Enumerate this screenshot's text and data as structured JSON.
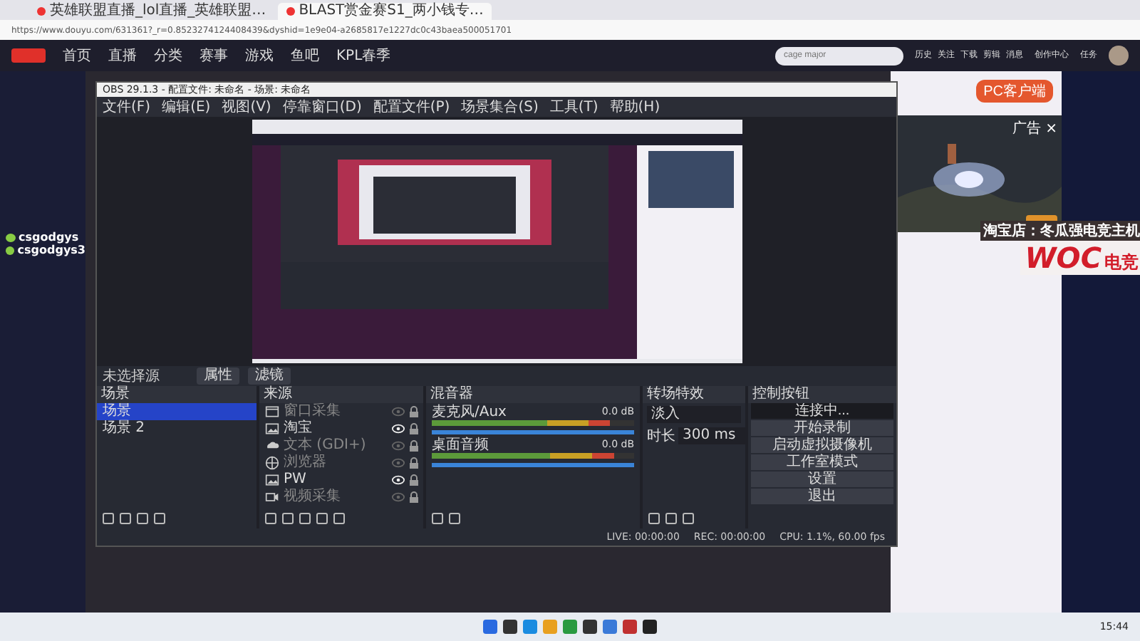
{
  "browser": {
    "tabs": [
      {
        "title": "英雄联盟直播_lol直播_英雄联盟…",
        "selected": false
      },
      {
        "title": "BLAST赏金赛S1_两小钱专…",
        "selected": true
      }
    ],
    "url": "https://www.douyu.com/631361?_r=0.8523274124408439&dyshid=1e9e04-a2685817e1227dc0c43baea500051701"
  },
  "site_nav": {
    "items": [
      "首页",
      "直播",
      "分类",
      "赛事",
      "游戏",
      "鱼吧",
      "KPL春季"
    ],
    "search": {
      "placeholder": "cage major"
    },
    "user_items": [
      "历史",
      "关注",
      "下载",
      "剪辑",
      "消息",
      "创作中心",
      "任务"
    ]
  },
  "chat": [
    "csgodgys",
    "csgodgys3"
  ],
  "obs": {
    "title": "OBS 29.1.3 - 配置文件: 未命名 - 场景: 未命名",
    "menu": [
      "文件(F)",
      "编辑(E)",
      "视图(V)",
      "停靠窗口(D)",
      "配置文件(P)",
      "场景集合(S)",
      "工具(T)",
      "帮助(H)"
    ],
    "source_bar": {
      "label": "未选择源",
      "buttons": [
        "属性",
        "滤镜"
      ]
    },
    "docks": {
      "scenes": {
        "title": "场景",
        "items": [
          {
            "name": "场景",
            "selected": true
          },
          {
            "name": "场景 2",
            "selected": false
          }
        ]
      },
      "sources": {
        "title": "来源",
        "items": [
          {
            "name": "窗口采集",
            "kind": "window",
            "visible": false
          },
          {
            "name": "淘宝",
            "visible": true
          },
          {
            "name": "文本 (GDI+)",
            "kind": "text",
            "visible": false
          },
          {
            "name": "浏览器",
            "kind": "browser",
            "visible": false
          },
          {
            "name": "PW",
            "visible": true
          },
          {
            "name": "视频采集",
            "kind": "video",
            "visible": false
          }
        ]
      },
      "mixer": {
        "title": "混音器",
        "channels": [
          {
            "name": "麦克风/Aux",
            "reading": "0.0 dB",
            "level": 0.88,
            "volume": {
              "level": 1
            }
          },
          {
            "name": "桌面音频",
            "reading": "0.0 dB",
            "level": 0.9,
            "volume": {
              "level": 1
            }
          }
        ]
      },
      "transitions": {
        "title": "转场特效",
        "transition": "淡入",
        "duration_label": "时长",
        "duration": "300 ms"
      },
      "controls": {
        "title": "控制按钮",
        "buttons": [
          {
            "label": "连接中...",
            "active": true
          },
          {
            "label": "开始录制",
            "active": false
          },
          {
            "label": "启动虚拟摄像机",
            "active": false
          },
          {
            "label": "工作室模式",
            "active": false
          },
          {
            "label": "设置",
            "active": false
          },
          {
            "label": "退出",
            "active": false
          }
        ]
      }
    },
    "status": {
      "live": "LIVE: 00:00:00",
      "rec": "REC: 00:00:00",
      "cpu": "CPU: 1.1%, 60.00 fps"
    }
  },
  "side_panel": {
    "client_button": "PC客户端",
    "ad_label": "广告 ×"
  },
  "overlay": {
    "shop": "淘宝店：冬瓜强电竞主机",
    "brand": "WOC",
    "brand_sub": "电竞"
  },
  "taskbar": {
    "time": "15:44"
  }
}
